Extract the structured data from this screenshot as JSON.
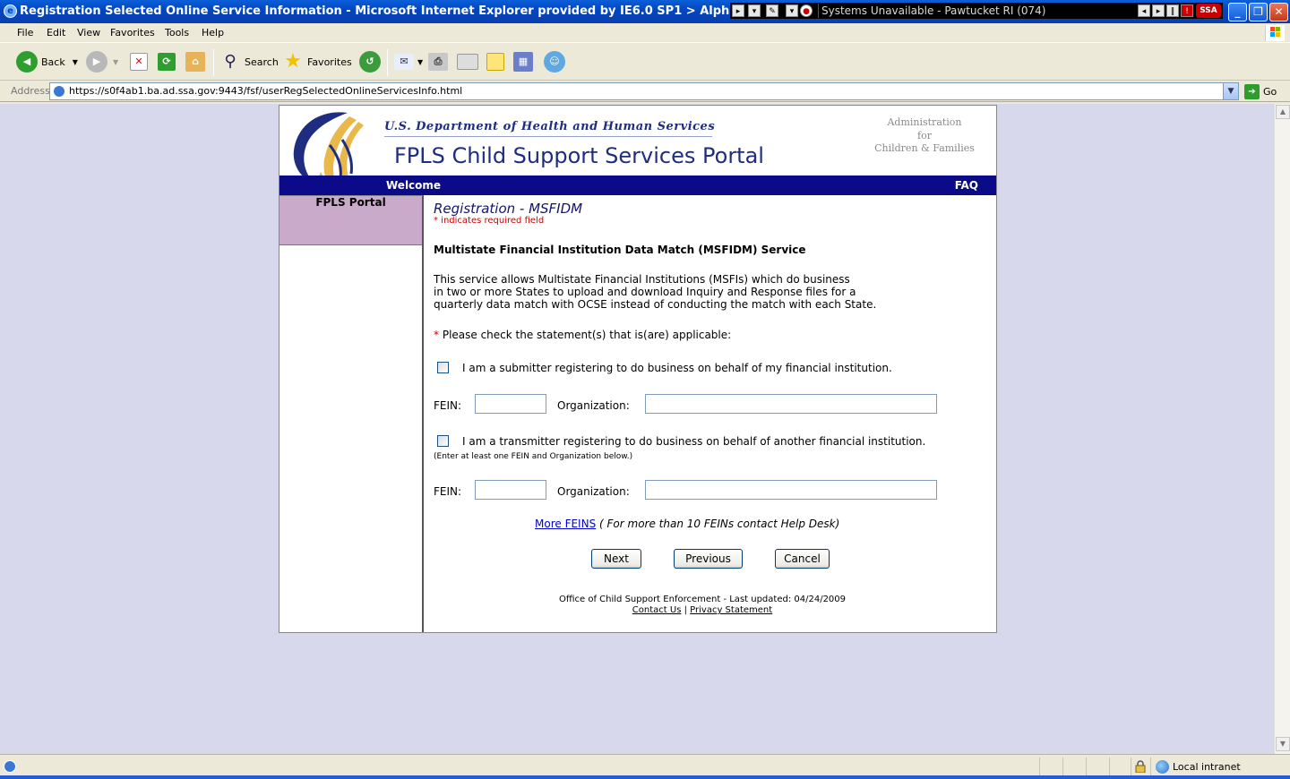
{
  "window": {
    "title": "Registration Selected Online Service Information - Microsoft Internet Explorer provided by IE6.0 SP1  > Alpha CI",
    "ticker_text": "Systems Unavailable - Pawtucket RI (074)",
    "ticker_badge": "SSA"
  },
  "menu": {
    "items": [
      "File",
      "Edit",
      "View",
      "Favorites",
      "Tools",
      "Help"
    ]
  },
  "toolbar": {
    "back": "Back",
    "search": "Search",
    "favorites": "Favorites"
  },
  "address": {
    "label": "Address",
    "url": "https://s0f4ab1.ba.ad.ssa.gov:9443/fsf/userRegSelectedOnlineServicesInfo.html",
    "go": "Go"
  },
  "header": {
    "department": "U.S. Department of Health and Human Services",
    "portal_title": "FPLS Child Support Services Portal",
    "acf_line1": "Administration",
    "acf_line2": "for",
    "acf_line3": "Children & Families",
    "welcome": "Welcome",
    "faq": "FAQ"
  },
  "leftnav": {
    "portal": "FPLS Portal"
  },
  "form": {
    "title": "Registration - MSFIDM",
    "required_note": "* indicates required field",
    "service_heading": "Multistate Financial Institution Data Match (MSFIDM) Service",
    "service_desc": "This service allows Multistate Financial Institutions (MSFIs) which do business\nin two or more States to upload and download Inquiry and Response files for a\nquarterly data match with OCSE instead of conducting the match with each State.",
    "instruction_star": "*",
    "instruction": "Please check the statement(s) that is(are) applicable:",
    "submitter_label": "I am a submitter registering to do business on behalf of my financial institution.",
    "transmitter_label": "I am a transmitter registering to do business on behalf of another financial institution.",
    "transmitter_note": "(Enter at least one FEIN and Organization below.)",
    "fein_label": "FEIN:",
    "org_label": "Organization:",
    "submitter_fein": "",
    "submitter_org": "",
    "transmitter_fein": "",
    "transmitter_org": "",
    "more_feins": "More FEINS",
    "more_feins_note": "( For more than 10 FEINs contact Help Desk)",
    "next": "Next",
    "previous": "Previous",
    "cancel": "Cancel"
  },
  "footer": {
    "line": "Office of Child Support Enforcement - Last updated: 04/24/2009",
    "contact": "Contact Us",
    "separator": "|",
    "privacy": "Privacy Statement"
  },
  "status": {
    "zone": "Local intranet"
  },
  "colors": {
    "nav_blue": "#0b0b8a",
    "portal_purple": "#c9aacb",
    "page_bg": "#d8d8ec",
    "required_red": "#cc0000"
  }
}
